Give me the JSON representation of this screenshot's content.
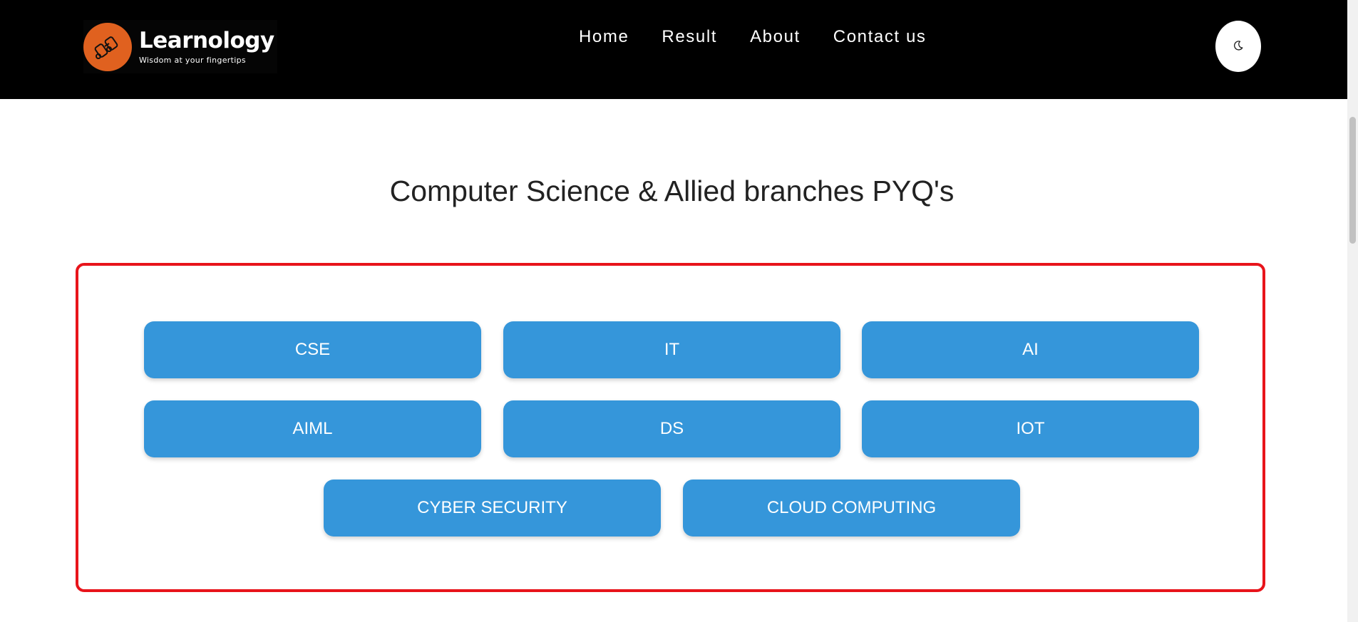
{
  "header": {
    "brand_name": "Learnology",
    "brand_tagline": "Wisdom at your fingertips",
    "logo_icon": "binoculars-icon",
    "nav": [
      {
        "label": "Home"
      },
      {
        "label": "Result"
      },
      {
        "label": "About"
      },
      {
        "label": "Contact us"
      }
    ],
    "theme_toggle_icon": "moon-icon",
    "colors": {
      "background": "#000000",
      "logo_accent": "#e0611f"
    }
  },
  "main": {
    "title": "Computer Science & Allied branches PYQ's",
    "branches": [
      {
        "label": "CSE"
      },
      {
        "label": "IT"
      },
      {
        "label": "AI"
      },
      {
        "label": "AIML"
      },
      {
        "label": "DS"
      },
      {
        "label": "IOT"
      },
      {
        "label": "CYBER SECURITY"
      },
      {
        "label": "CLOUD COMPUTING"
      }
    ],
    "colors": {
      "button": "#3596da",
      "panel_border": "#e8141b"
    }
  }
}
